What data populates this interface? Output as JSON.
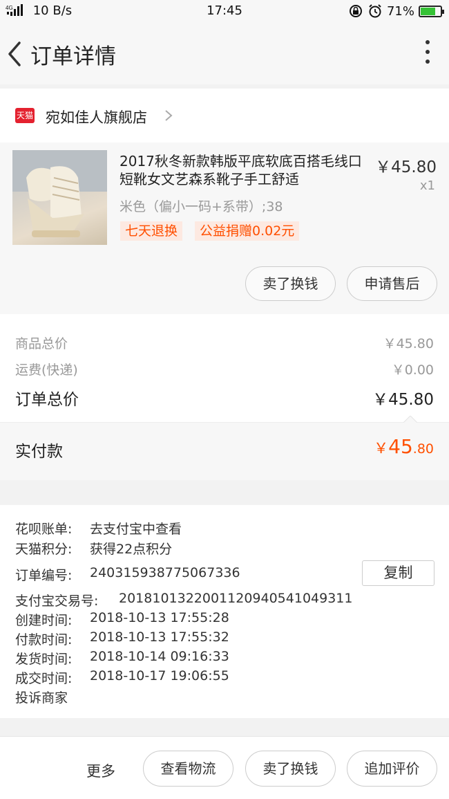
{
  "status_bar": {
    "network": "4G",
    "speed": "10 B/s",
    "time": "17:45",
    "battery": "71%"
  },
  "nav": {
    "title": "订单详情"
  },
  "shop": {
    "badge": "天猫",
    "name": "宛如佳人旗舰店"
  },
  "product": {
    "title": "2017秋冬新款韩版平底软底百搭毛线口短靴女文艺森系靴子手工舒适",
    "price": "￥45.80",
    "qty": "x1",
    "spec": "米色（偏小一码+系带）;38",
    "tags": [
      "七天退换",
      "公益捐赠0.02元"
    ],
    "buttons": {
      "sell": "卖了换钱",
      "after_sale": "申请售后"
    }
  },
  "summary": {
    "goods_total_label": "商品总价",
    "goods_total": "￥45.80",
    "shipping_label": "运费(快递)",
    "shipping": "￥0.00",
    "order_total_label": "订单总价",
    "order_total": "￥45.80",
    "paid_label": "实付款",
    "paid_symbol": "￥",
    "paid_int": "45",
    "paid_dec": ".80"
  },
  "info": {
    "rows": [
      {
        "k": "花呗账单:",
        "v": "去支付宝中查看"
      },
      {
        "k": "天猫积分:",
        "v": "获得22点积分"
      },
      {
        "k": "订单编号:",
        "v": "240315938775067336"
      },
      {
        "k": "支付宝交易号:",
        "v": "2018101322001120940541049311"
      },
      {
        "k": "创建时间:",
        "v": "2018-10-13 17:55:28"
      },
      {
        "k": "付款时间:",
        "v": "2018-10-13 17:55:32"
      },
      {
        "k": "发货时间:",
        "v": "2018-10-14 09:16:33"
      },
      {
        "k": "成交时间:",
        "v": "2018-10-17 19:06:55"
      }
    ],
    "complaint": "投诉商家",
    "copy_label": "复制"
  },
  "bottom": {
    "more": "更多",
    "logistics": "查看物流",
    "sell": "卖了换钱",
    "review": "追加评价"
  },
  "colors": {
    "accent": "#ff5000",
    "tmall_red": "#e4212f",
    "battery_green": "#35c235"
  }
}
